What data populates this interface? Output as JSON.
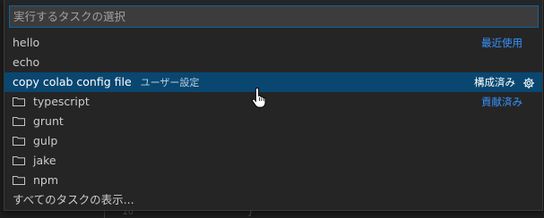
{
  "search": {
    "placeholder": "実行するタスクの選択",
    "value": ""
  },
  "rows": [
    {
      "label": "hello",
      "right": "最近使用",
      "folder": false
    },
    {
      "label": "echo",
      "right": "",
      "folder": false
    },
    {
      "label": "copy colab config file",
      "description": "ユーザー設定",
      "right": "構成済み",
      "folder": false,
      "selected": true
    },
    {
      "label": "typescript",
      "right": "貢献済み",
      "folder": true
    },
    {
      "label": "grunt",
      "right": "",
      "folder": true
    },
    {
      "label": "gulp",
      "right": "",
      "folder": true
    },
    {
      "label": "jake",
      "right": "",
      "folder": true
    },
    {
      "label": "npm",
      "right": "",
      "folder": true
    },
    {
      "label": "すべてのタスクの表示...",
      "right": "",
      "folder": false
    }
  ],
  "editor": {
    "line_number": "10",
    "bracket": "}"
  },
  "colors": {
    "accent": "#3794ff",
    "selection": "#094771",
    "focus_border": "#0e639c"
  }
}
